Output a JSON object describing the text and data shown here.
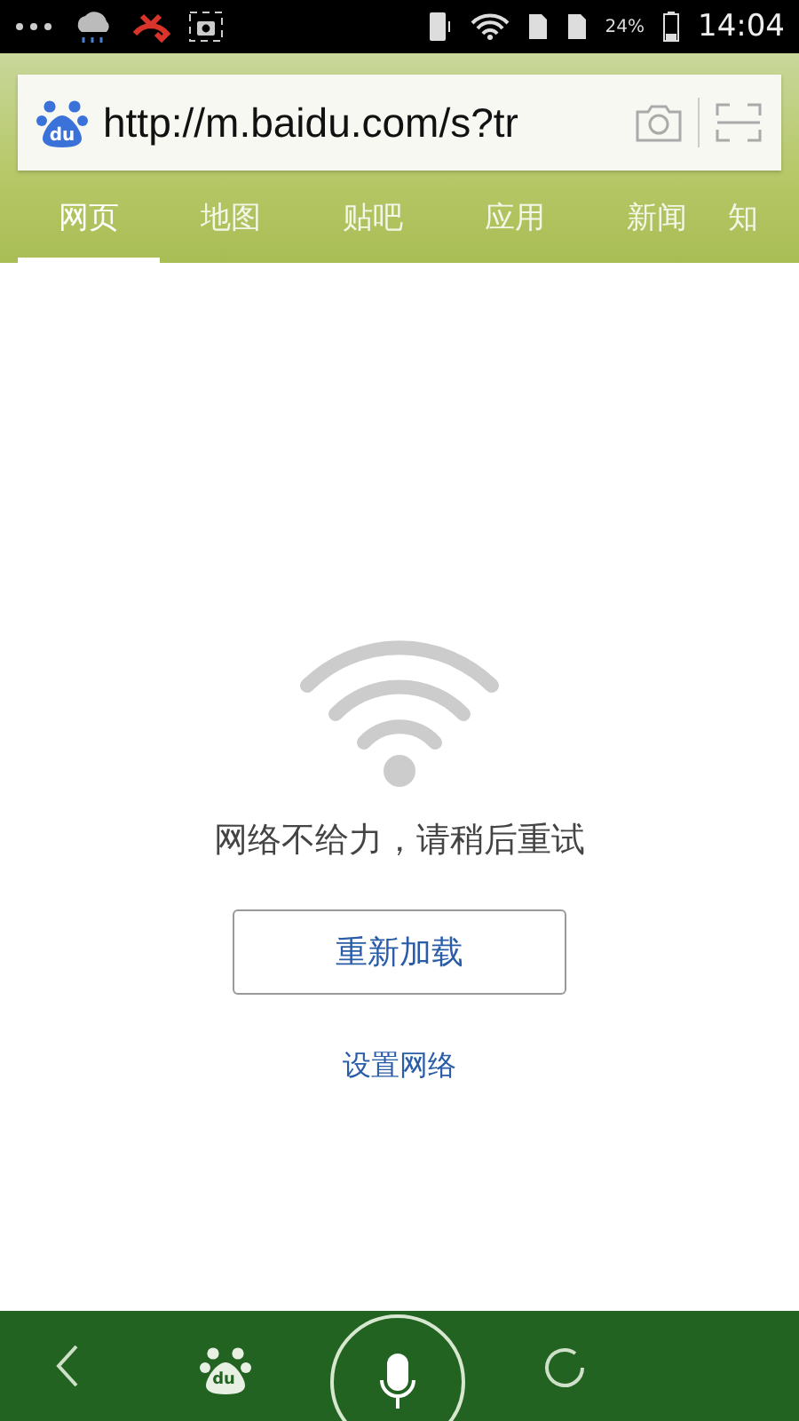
{
  "status_bar": {
    "battery": "24%",
    "time": "14:04"
  },
  "address_bar": {
    "logo_text": "du",
    "url": "http://m.baidu.com/s?tr"
  },
  "tabs": [
    {
      "label": "网页",
      "selected": true
    },
    {
      "label": "地图",
      "selected": false
    },
    {
      "label": "贴吧",
      "selected": false
    },
    {
      "label": "应用",
      "selected": false
    },
    {
      "label": "新闻",
      "selected": false
    },
    {
      "label": "知",
      "selected": false
    }
  ],
  "error": {
    "message": "网络不给力，请稍后重试",
    "retry_button": "重新加载",
    "settings_link": "设置网络"
  },
  "bottom_bar": {
    "logo_text": "du"
  }
}
